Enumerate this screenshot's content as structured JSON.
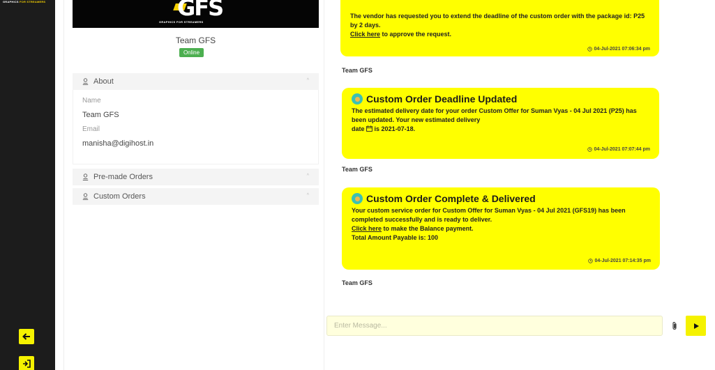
{
  "rail": {
    "brand_white": "GRAPHICS ",
    "brand_yellow": "FOR STREAMERS"
  },
  "profile": {
    "logo_text": "GFS",
    "logo_sub": "GRAPHICS FOR STREAMERS",
    "name": "Team GFS",
    "status": "Online",
    "sections": [
      {
        "label": "About",
        "expanded": true
      },
      {
        "label": "Pre-made Orders",
        "expanded": false
      },
      {
        "label": "Custom Orders",
        "expanded": false
      }
    ],
    "about": {
      "name_label": "Name",
      "name_value": "Team GFS",
      "email_label": "Email",
      "email_value": "manisha@digihost.in"
    }
  },
  "chat": {
    "messages": [
      {
        "text": "The vendor has requested you to extend the deadline of the custom order with the package id: P25 by 2 days.",
        "link": "Click here",
        "link_suffix": " to approve the request.",
        "timestamp": "04-Jul-2021 07:06:34 pm",
        "sender": "Team GFS"
      },
      {
        "title": "Custom Order Deadline Updated",
        "text": "The estimated delivery date for your order Custom Offer for Suman Vyas - 04 Jul 2021 (P25) has been updated. Your new estimated delivery",
        "text_date_prefix": "date",
        "text_date_suffix": "is 2021-07-18.",
        "timestamp": "04-Jul-2021 07:07:44 pm",
        "sender": "Team GFS"
      },
      {
        "title": "Custom Order Complete & Delivered",
        "text": "Your custom service order for Custom Offer for Suman Vyas - 04 Jul 2021 (GFS19) has been completed successfully and is ready to deliver.",
        "link": "Click here",
        "link_suffix": " to make the Balance payment.",
        "total": "Total Amount Payable is: 100",
        "timestamp": "04-Jul-2021 07:14:35 pm",
        "sender": "Team GFS"
      }
    ],
    "composer_placeholder": "Enter Message..."
  },
  "colors": {
    "accent_yellow": "#ffff00",
    "button_yellow": "#f5f200",
    "online_green": "#4caf50",
    "rail_dark": "#1c1c1c"
  }
}
